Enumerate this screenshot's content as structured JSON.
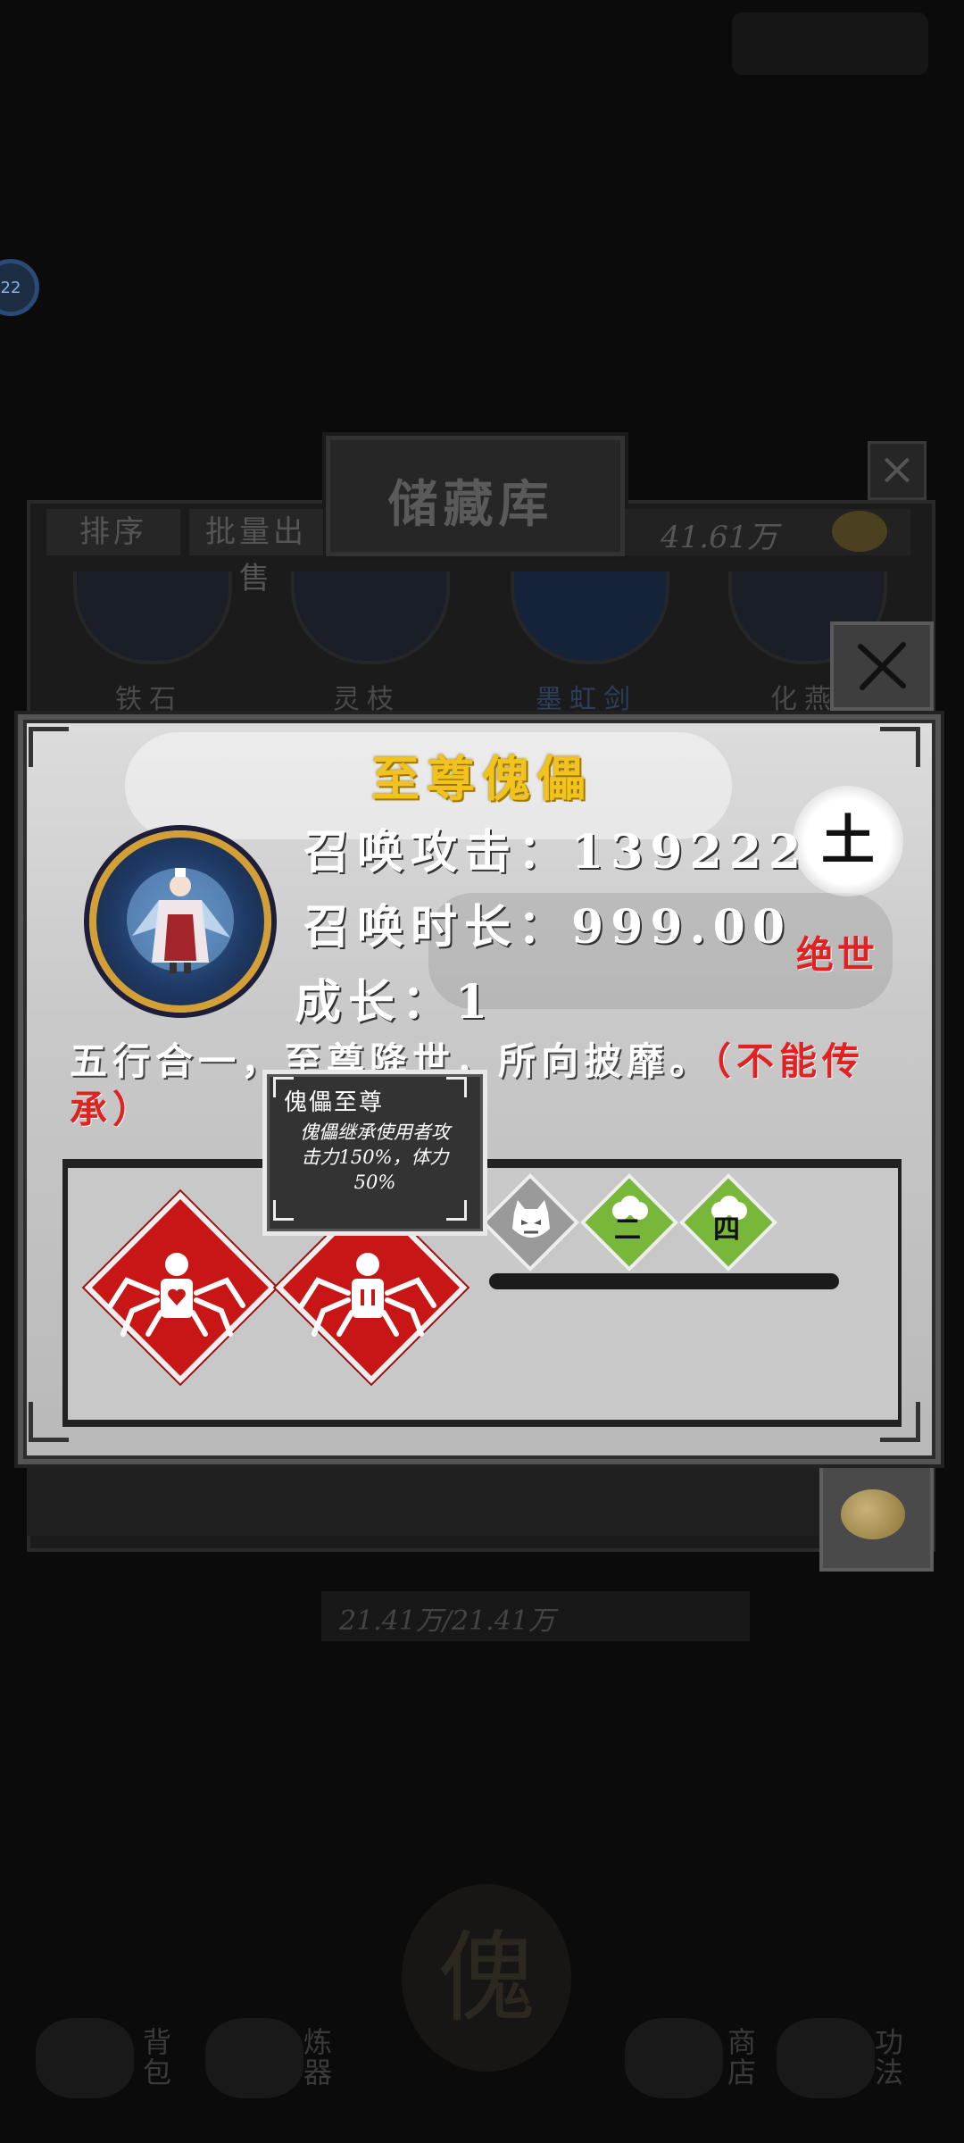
{
  "background": {
    "storage_title": "储藏库",
    "sort_label": "排序",
    "batch_sell_label": "批量出售",
    "currency": "41.61万",
    "categories": [
      "铁石",
      "灵枝",
      "墨虹剑",
      "化燕"
    ],
    "capacity": "21.41万/21.41万",
    "badge_text": "22",
    "center_char": "傀",
    "nav": [
      {
        "label": "背包",
        "icon": "bag-icon"
      },
      {
        "label": "炼器",
        "icon": "furnace-icon"
      },
      {
        "label": "商店",
        "icon": "shop-icon"
      },
      {
        "label": "功法",
        "icon": "book-icon"
      }
    ]
  },
  "item": {
    "name": "至尊傀儡",
    "summon_attack": "召唤攻击：139222",
    "summon_duration": "召唤时长：999.00",
    "growth": "成长：1",
    "element": "土",
    "rarity": "绝世",
    "description_prefix": "五行合一，至尊降世，所向披靡。",
    "description_suffix": "（不能传承）"
  },
  "skills": {
    "small": [
      {
        "label": "",
        "icon": "demon-face-icon",
        "color": "#9a9a9a"
      },
      {
        "label": "二",
        "icon": "cloud-icon",
        "color": "#79b73a"
      },
      {
        "label": "四",
        "icon": "cloud-icon",
        "color": "#79b73a"
      }
    ],
    "big": [
      {
        "icon": "spider-puppet-heart-icon",
        "color": "#c81616"
      },
      {
        "icon": "spider-puppet-body-icon",
        "color": "#c81616"
      }
    ]
  },
  "tooltip": {
    "title": "傀儡至尊",
    "body": "傀儡继承使用者攻击力150%，体力50%"
  },
  "colors": {
    "title_gold": "#f2c31f",
    "rarity_red": "#e02222",
    "skill_red": "#c81616",
    "skill_green": "#79b73a"
  }
}
